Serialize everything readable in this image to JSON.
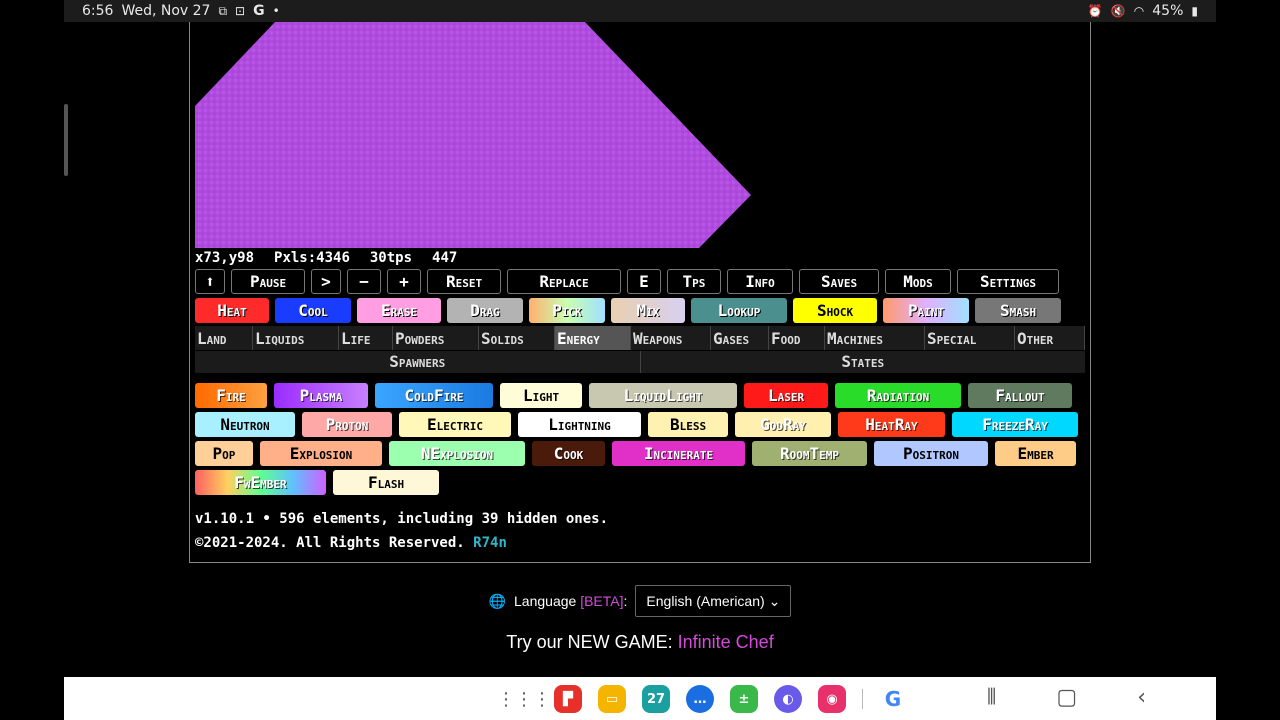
{
  "status_bar": {
    "time": "6:56",
    "date": "Wed, Nov 27",
    "battery": "45%",
    "left_icons": [
      "screenshot-icon",
      "screen-record-icon",
      "google-icon",
      "dot-icon"
    ],
    "right_icons": [
      "alarm-icon",
      "mute-icon",
      "wifi-icon",
      "battery-icon"
    ]
  },
  "canvas": {
    "blob_color": "#b04be0"
  },
  "stats": {
    "coords": "x73,y98",
    "pixels": "Pxls:4346",
    "tps": "30tps",
    "tick": "447"
  },
  "controls": [
    "⬆",
    "Pause",
    ">",
    "−",
    "+",
    "Reset",
    "Replace",
    "E",
    "Tps",
    "Info",
    "Saves",
    "Mods",
    "Settings"
  ],
  "tools": [
    {
      "label": "Heat",
      "bg": "#ff2a2a",
      "fg": "#fff"
    },
    {
      "label": "Cool",
      "bg": "#1a3cff",
      "fg": "#fff"
    },
    {
      "label": "Erase",
      "bg": "#ff9ee2",
      "fg": "#fff"
    },
    {
      "label": "Drag",
      "bg": "#b3b3b3",
      "fg": "#fff"
    },
    {
      "label": "Pick",
      "bg": "linear-gradient(90deg,#ffb070,#c8ffb0,#a0e0ff)",
      "fg": "#fff"
    },
    {
      "label": "Mix",
      "bg": "linear-gradient(90deg,#e8d0b0,#d8d0f0)",
      "fg": "#fff"
    },
    {
      "label": "Lookup",
      "bg": "#4b8f8f",
      "fg": "#fff"
    },
    {
      "label": "Shock",
      "bg": "#ffff00",
      "fg": "#000"
    },
    {
      "label": "Paint",
      "bg": "linear-gradient(90deg,#ff9a6a,#e0b0ff,#9fe0ff)",
      "fg": "#fff"
    },
    {
      "label": "Smash",
      "bg": "#777777",
      "fg": "#fff"
    }
  ],
  "categories": [
    "Land",
    "Liquids",
    "Life",
    "Powders",
    "Solids",
    "Energy",
    "Weapons",
    "Gases",
    "Food",
    "Machines",
    "Special",
    "Other"
  ],
  "active_category": "Energy",
  "subcategories": [
    "Spawners",
    "States"
  ],
  "elements": [
    [
      {
        "label": "Fire",
        "bg": "linear-gradient(90deg,#ff6a00,#ffa040)",
        "w": 72,
        "dark": false
      },
      {
        "label": "Plasma",
        "bg": "linear-gradient(90deg,#9a2cff,#c880ff)",
        "w": 94,
        "dark": false
      },
      {
        "label": "ColdFire",
        "bg": "linear-gradient(90deg,#3aa6ff,#1a7ae0)",
        "w": 118,
        "dark": false
      },
      {
        "label": "Light",
        "bg": "#fffcd8",
        "w": 82,
        "dark": true
      },
      {
        "label": "LiquidLight",
        "bg": "#c8c8b0",
        "w": 148,
        "dark": false
      },
      {
        "label": "Laser",
        "bg": "#ff1a1a",
        "w": 84,
        "dark": false
      },
      {
        "label": "Radiation",
        "bg": "#2adc2a",
        "w": 126,
        "dark": false
      },
      {
        "label": "Fallout",
        "bg": "#5f7a5f",
        "w": 104,
        "dark": false
      }
    ],
    [
      {
        "label": "Neutron",
        "bg": "#a8f0ff",
        "w": 100,
        "dark": true
      },
      {
        "label": "Proton",
        "bg": "#ffa8a8",
        "w": 90,
        "dark": false
      },
      {
        "label": "Electric",
        "bg": "#fff8b8",
        "w": 112,
        "dark": true
      },
      {
        "label": "Lightning",
        "bg": "#ffffff",
        "w": 123,
        "dark": true
      },
      {
        "label": "Bless",
        "bg": "#fff2b0",
        "w": 80,
        "dark": true
      },
      {
        "label": "GodRay",
        "bg": "#fff0b0",
        "w": 96,
        "dark": false
      },
      {
        "label": "HeatRay",
        "bg": "#ff3a1a",
        "w": 107,
        "dark": false
      },
      {
        "label": "FreezeRay",
        "bg": "#00d8ff",
        "w": 126,
        "dark": false
      }
    ],
    [
      {
        "label": "Pop",
        "bg": "#ffcf9a",
        "w": 58,
        "dark": true
      },
      {
        "label": "Explosion",
        "bg": "#ffb088",
        "w": 122,
        "dark": true
      },
      {
        "label": "NExplosion",
        "bg": "#9cffb0",
        "w": 136,
        "dark": false
      },
      {
        "label": "Cook",
        "bg": "#4a1a0a",
        "w": 73,
        "dark": false
      },
      {
        "label": "Incinerate",
        "bg": "#e030c8",
        "w": 133,
        "dark": false
      },
      {
        "label": "RoomTemp",
        "bg": "#a0b070",
        "w": 115,
        "dark": false
      },
      {
        "label": "Positron",
        "bg": "#b0c8ff",
        "w": 114,
        "dark": true
      },
      {
        "label": "Ember",
        "bg": "#ffcc88",
        "w": 81,
        "dark": true
      }
    ],
    [
      {
        "label": "FwEmber",
        "bg": "linear-gradient(90deg,#ff6060,#ffd060,#60ff90,#60c0ff,#d060ff)",
        "w": 131,
        "dark": false
      },
      {
        "label": "Flash",
        "bg": "#fff8d8",
        "w": 106,
        "dark": true
      }
    ]
  ],
  "footer": {
    "version_line": "v1.10.1 • 596 elements, including 39 hidden ones.",
    "copyright": "©2021-2024. All Rights Reserved.",
    "author": "R74n"
  },
  "language": {
    "label": "Language",
    "beta": "[BETA]",
    "colon": ":",
    "selected": "English (American)"
  },
  "promo": {
    "prefix": "Try our NEW GAME: ",
    "link": "Infinite Chef"
  },
  "navbar": {
    "apps": [
      {
        "icon": "app-drawer-icon"
      },
      {
        "icon": "flipboard-icon",
        "color": "#e8302a"
      },
      {
        "icon": "my-files-icon",
        "color": "#f5b400"
      },
      {
        "icon": "calendar-icon",
        "color": "#1aa0a0",
        "text": "27"
      },
      {
        "icon": "messages-icon",
        "color": "#1a6ee0"
      },
      {
        "icon": "calculator-icon",
        "color": "#3ab84a"
      },
      {
        "icon": "internet-icon",
        "color": "#6a5ae8"
      },
      {
        "icon": "screen-recorder-icon",
        "color": "#e8306a"
      },
      {
        "icon": "chrome-icon"
      }
    ]
  }
}
